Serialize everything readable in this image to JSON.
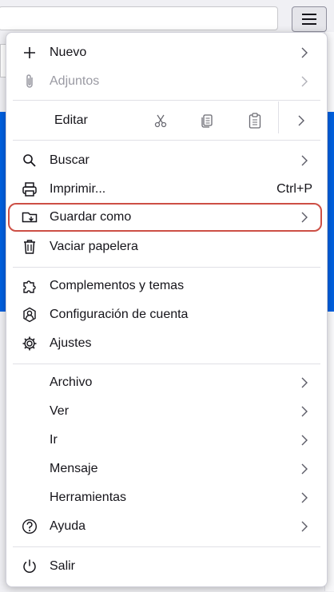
{
  "menu": {
    "items": [
      {
        "label": "Nuevo",
        "icon": "plus-icon",
        "has_submenu": true
      },
      {
        "label": "Adjuntos",
        "icon": "paperclip-icon",
        "has_submenu": true,
        "disabled": true
      },
      {
        "label": "Editar",
        "tools": [
          "scissors-icon",
          "copy-icon",
          "paste-icon"
        ],
        "has_submenu": true
      },
      {
        "label": "Buscar",
        "icon": "search-icon",
        "has_submenu": true
      },
      {
        "label": "Imprimir...",
        "icon": "printer-icon",
        "shortcut": "Ctrl+P"
      },
      {
        "label": "Guardar como",
        "icon": "folder-save-icon",
        "has_submenu": true,
        "highlighted": true
      },
      {
        "label": "Vaciar papelera",
        "icon": "trash-icon"
      },
      {
        "label": "Complementos y temas",
        "icon": "puzzle-icon"
      },
      {
        "label": "Configuración de cuenta",
        "icon": "account-settings-icon"
      },
      {
        "label": "Ajustes",
        "icon": "gear-icon"
      },
      {
        "label": "Archivo",
        "has_submenu": true
      },
      {
        "label": "Ver",
        "has_submenu": true
      },
      {
        "label": "Ir",
        "has_submenu": true
      },
      {
        "label": "Mensaje",
        "has_submenu": true
      },
      {
        "label": "Herramientas",
        "has_submenu": true
      },
      {
        "label": "Ayuda",
        "icon": "help-icon",
        "has_submenu": true
      },
      {
        "label": "Salir",
        "icon": "power-icon"
      }
    ]
  },
  "colors": {
    "highlight_border": "#cd4f45",
    "accent": "#0060df"
  }
}
